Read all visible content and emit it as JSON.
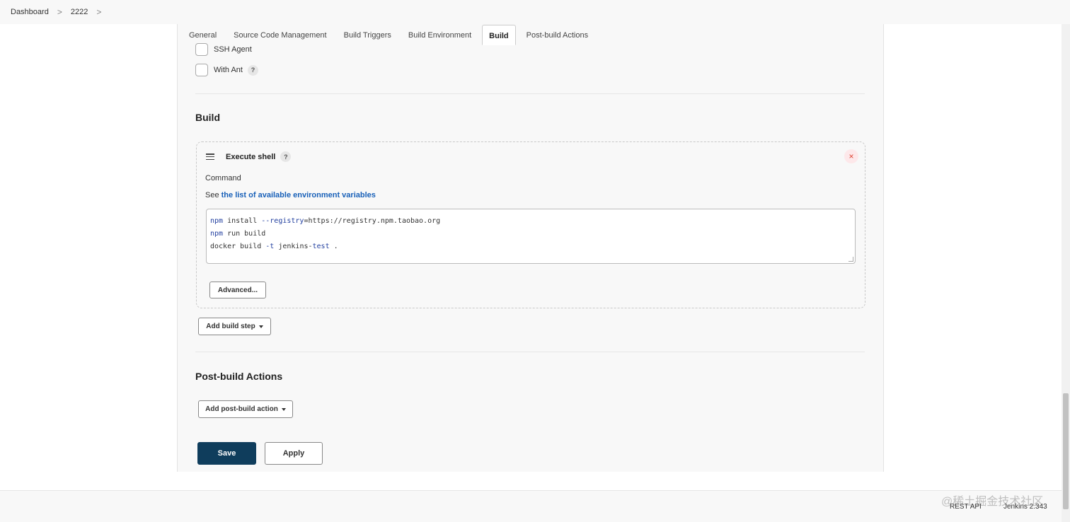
{
  "breadcrumb": {
    "items": [
      "Dashboard",
      "2222"
    ],
    "separator": ">"
  },
  "tabs": [
    {
      "label": "General",
      "active": false
    },
    {
      "label": "Source Code Management",
      "active": false
    },
    {
      "label": "Build Triggers",
      "active": false
    },
    {
      "label": "Build Environment",
      "active": false
    },
    {
      "label": "Build",
      "active": true
    },
    {
      "label": "Post-build Actions",
      "active": false
    }
  ],
  "build_environment": {
    "options": [
      {
        "label": "SSH Agent",
        "checked": false,
        "help": false
      },
      {
        "label": "With Ant",
        "checked": false,
        "help": true
      }
    ]
  },
  "help_glyph": "?",
  "build_section": {
    "title": "Build",
    "step": {
      "title": "Execute shell",
      "close_glyph": "×",
      "command_label": "Command",
      "env_prefix": "See",
      "env_link": "the list of available environment variables",
      "code_lines": [
        "npm install --registry=https://registry.npm.taobao.org",
        "npm run build",
        "docker build -t jenkins-test ."
      ],
      "advanced_label": "Advanced..."
    },
    "add_step_label": "Add build step"
  },
  "post_build": {
    "title": "Post-build Actions",
    "add_action_label": "Add post-build action"
  },
  "actions": {
    "save_label": "Save",
    "apply_label": "Apply"
  },
  "footer": {
    "rest_api": "REST API",
    "version": "Jenkins 2.343"
  },
  "watermark": "@稀土掘金技术社区",
  "colors": {
    "primary": "#0f3d5c",
    "link": "#1860b8",
    "panel": "#f8f8f8"
  }
}
